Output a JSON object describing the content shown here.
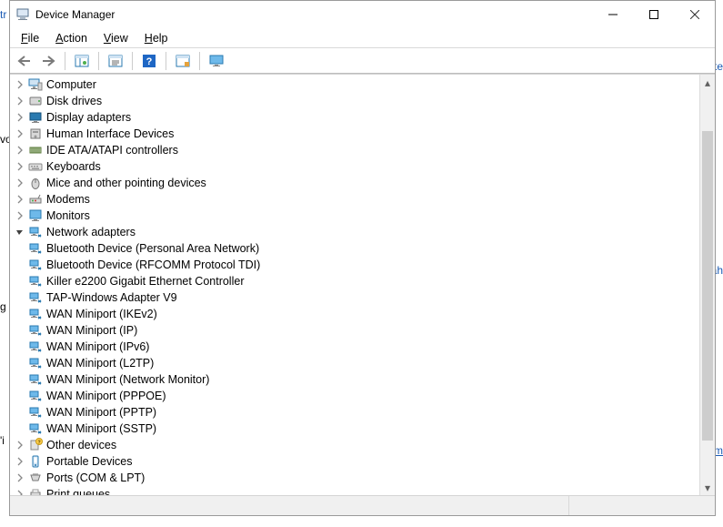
{
  "window": {
    "title": "Device Manager"
  },
  "menu": {
    "file": "File",
    "action": "Action",
    "view": "View",
    "help": "Help"
  },
  "toolbar": {
    "back": "Back",
    "forward": "Forward",
    "show_hide": "Show/Hide Console Tree",
    "properties": "Properties",
    "help": "Help",
    "refresh": "Refresh",
    "display_monitor": "Display Monitor"
  },
  "tree": {
    "items": [
      {
        "icon": "computer-icon",
        "label": "Computer",
        "expandable": true
      },
      {
        "icon": "disk-icon",
        "label": "Disk drives",
        "expandable": true
      },
      {
        "icon": "display-icon",
        "label": "Display adapters",
        "expandable": true
      },
      {
        "icon": "hid-icon",
        "label": "Human Interface Devices",
        "expandable": true
      },
      {
        "icon": "ide-icon",
        "label": "IDE ATA/ATAPI controllers",
        "expandable": true
      },
      {
        "icon": "keyboard-icon",
        "label": "Keyboards",
        "expandable": true
      },
      {
        "icon": "mouse-icon",
        "label": "Mice and other pointing devices",
        "expandable": true
      },
      {
        "icon": "modem-icon",
        "label": "Modems",
        "expandable": true
      },
      {
        "icon": "monitor-icon",
        "label": "Monitors",
        "expandable": true
      },
      {
        "icon": "network-icon",
        "label": "Network adapters",
        "expandable": true,
        "expanded": true,
        "children": [
          {
            "icon": "network-icon",
            "label": "Bluetooth Device (Personal Area Network)"
          },
          {
            "icon": "network-icon",
            "label": "Bluetooth Device (RFCOMM Protocol TDI)"
          },
          {
            "icon": "network-icon",
            "label": "Killer e2200 Gigabit Ethernet Controller"
          },
          {
            "icon": "network-icon",
            "label": "TAP-Windows Adapter V9"
          },
          {
            "icon": "network-icon",
            "label": "WAN Miniport (IKEv2)"
          },
          {
            "icon": "network-icon",
            "label": "WAN Miniport (IP)"
          },
          {
            "icon": "network-icon",
            "label": "WAN Miniport (IPv6)"
          },
          {
            "icon": "network-icon",
            "label": "WAN Miniport (L2TP)"
          },
          {
            "icon": "network-icon",
            "label": "WAN Miniport (Network Monitor)"
          },
          {
            "icon": "network-icon",
            "label": "WAN Miniport (PPPOE)"
          },
          {
            "icon": "network-icon",
            "label": "WAN Miniport (PPTP)"
          },
          {
            "icon": "network-icon",
            "label": "WAN Miniport (SSTP)"
          }
        ]
      },
      {
        "icon": "other-icon",
        "label": "Other devices",
        "expandable": true
      },
      {
        "icon": "portable-icon",
        "label": "Portable Devices",
        "expandable": true
      },
      {
        "icon": "port-icon",
        "label": "Ports (COM & LPT)",
        "expandable": true
      },
      {
        "icon": "printer-icon",
        "label": "Print queues",
        "expandable": true
      }
    ]
  },
  "hints": {
    "tr": "tr",
    "vo": "vo",
    "te": "te",
    "ah": "ah",
    "g": "g",
    "i": "'i",
    "m": "m"
  }
}
